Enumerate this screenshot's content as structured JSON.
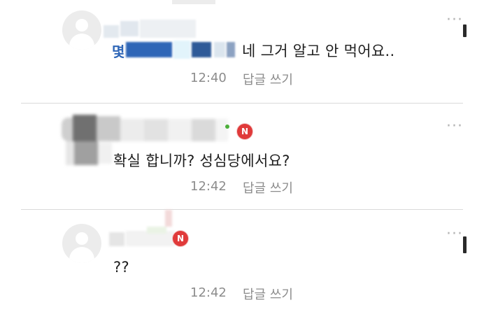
{
  "comments": [
    {
      "name_visible": "몇",
      "text": "네 그거 알고 안 먹어요..",
      "time": "12:40",
      "reply": "답글 쓰기",
      "more": "···"
    },
    {
      "badge": "N",
      "text": "확실 합니까? 성심당에서요?",
      "time": "12:42",
      "reply": "답글 쓰기",
      "more": "···"
    },
    {
      "badge": "N",
      "text": "??",
      "time": "12:42",
      "reply": "답글 쓰기",
      "more": "···"
    }
  ],
  "colors": {
    "badge": "#e03a3a",
    "meta": "#8c8c8c",
    "divider": "#d9d9d9",
    "avatar": "#ececec"
  }
}
